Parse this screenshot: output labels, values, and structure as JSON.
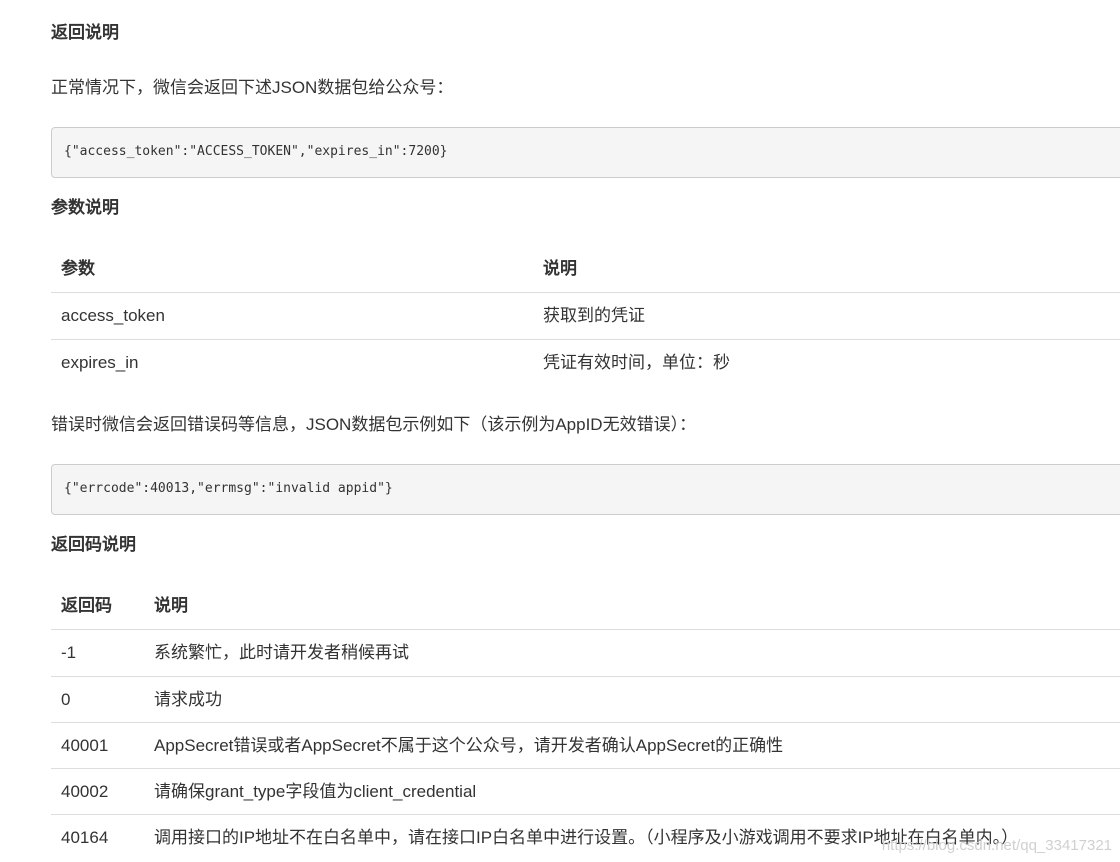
{
  "return_section": {
    "heading": "返回说明",
    "intro": "正常情况下，微信会返回下述JSON数据包给公众号：",
    "code": "{\"access_token\":\"ACCESS_TOKEN\",\"expires_in\":7200}"
  },
  "param_section": {
    "heading": "参数说明",
    "columns": [
      "参数",
      "说明"
    ],
    "rows": [
      [
        "access_token",
        "获取到的凭证"
      ],
      [
        "expires_in",
        "凭证有效时间，单位：秒"
      ]
    ]
  },
  "error_section": {
    "intro": "错误时微信会返回错误码等信息，JSON数据包示例如下（该示例为AppID无效错误）：",
    "code": "{\"errcode\":40013,\"errmsg\":\"invalid appid\"}"
  },
  "code_section": {
    "heading": "返回码说明",
    "columns": [
      "返回码",
      "说明"
    ],
    "rows": [
      [
        "-1",
        "系统繁忙，此时请开发者稍候再试"
      ],
      [
        "0",
        "请求成功"
      ],
      [
        "40001",
        "AppSecret错误或者AppSecret不属于这个公众号，请开发者确认AppSecret的正确性"
      ],
      [
        "40002",
        "请确保grant_type字段值为client_credential"
      ],
      [
        "40164",
        "调用接口的IP地址不在白名单中，请在接口IP白名单中进行设置。（小程序及小游戏调用不要求IP地址在白名单内。）"
      ]
    ]
  },
  "watermark": "https://blog.csdn.net/qq_33417321"
}
